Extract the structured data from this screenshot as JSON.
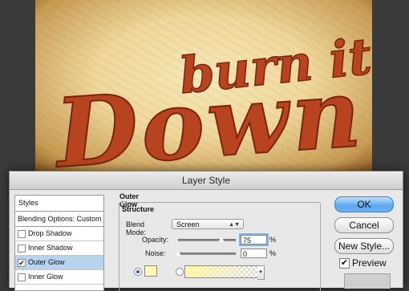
{
  "artwork": {
    "line1": "burn it",
    "line2": "Down",
    "ink_color": "#b8431f"
  },
  "dialog": {
    "title": "Layer Style",
    "styles_list": {
      "header": "Styles",
      "blending": "Blending Options: Custom",
      "items": [
        {
          "label": "Drop Shadow",
          "checked": false
        },
        {
          "label": "Inner Shadow",
          "checked": false
        },
        {
          "label": "Outer Glow",
          "checked": true,
          "selected": true
        },
        {
          "label": "Inner Glow",
          "checked": false
        }
      ]
    },
    "panel": {
      "title": "Outer Glow",
      "group": "Structure",
      "blend_mode_label": "Blend Mode:",
      "blend_mode_value": "Screen",
      "opacity_label": "Opacity:",
      "opacity_value": "75",
      "opacity_pct": 0.75,
      "noise_label": "Noise:",
      "noise_value": "0",
      "noise_pct": 0.0,
      "percent": "%",
      "glow_color": "#fff6b8"
    },
    "buttons": {
      "ok": "OK",
      "cancel": "Cancel",
      "new_style": "New Style...",
      "preview_label": "Preview",
      "preview_checked": true
    }
  }
}
